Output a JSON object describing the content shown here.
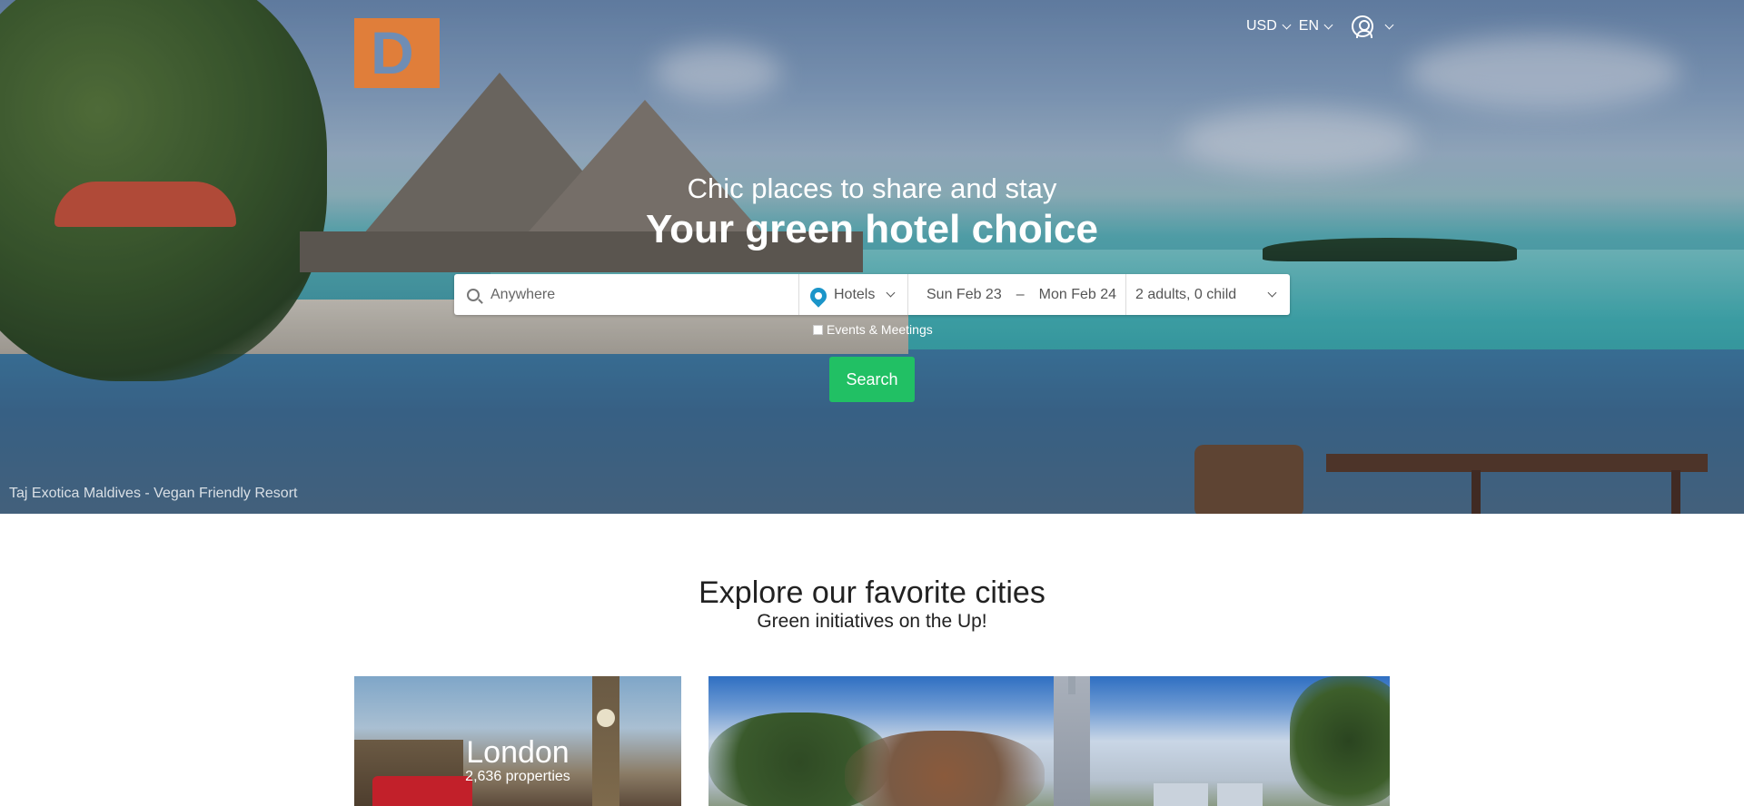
{
  "brand": {
    "logo_letter": "D"
  },
  "topnav": {
    "currency": "USD",
    "language": "EN"
  },
  "hero": {
    "subtitle": "Chic places to share and stay",
    "headline": "Your green hotel choice",
    "caption": "Taj Exotica Maldives - Vegan Friendly Resort"
  },
  "search": {
    "destination_placeholder": "Anywhere",
    "type": "Hotels",
    "checkin": "Sun Feb 23",
    "date_separator": "–",
    "checkout": "Mon Feb 24",
    "guests": "2 adults, 0 child",
    "events_label": "Events & Meetings",
    "button_label": "Search"
  },
  "explore": {
    "title": "Explore our favorite cities",
    "subtitle": "Green initiatives on the Up!",
    "cities": [
      {
        "name": "London",
        "count": "2,636 properties"
      }
    ]
  }
}
